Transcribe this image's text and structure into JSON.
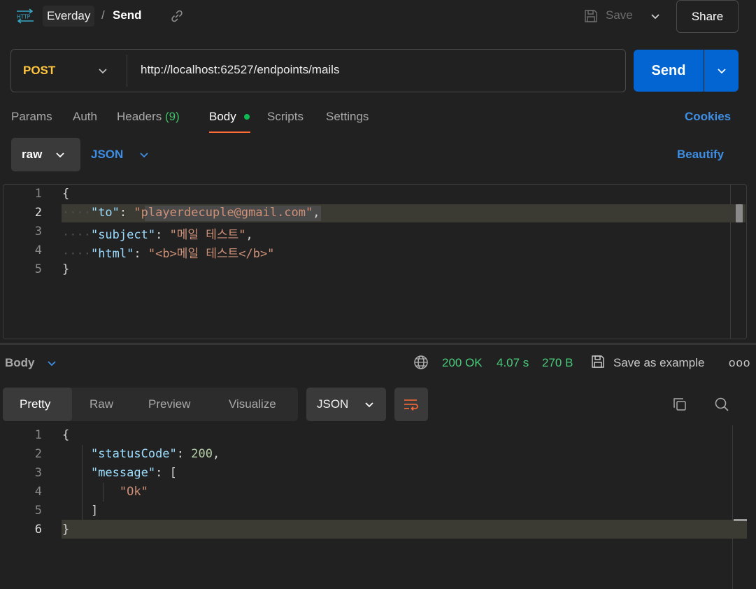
{
  "topbar": {
    "icon_label": "HTTP",
    "workspace": "Everday",
    "separator": "/",
    "request_name": "Send",
    "save_label": "Save",
    "share_label": "Share"
  },
  "request": {
    "method": "POST",
    "url": "http://localhost:62527/endpoints/mails",
    "send_label": "Send"
  },
  "tabs": {
    "params": "Params",
    "auth": "Auth",
    "headers": "Headers",
    "headers_count": "(9)",
    "body": "Body",
    "scripts": "Scripts",
    "settings": "Settings",
    "cookies": "Cookies"
  },
  "body_options": {
    "mode": "raw",
    "language": "JSON",
    "beautify": "Beautify"
  },
  "request_body": {
    "line_numbers": [
      "1",
      "2",
      "3",
      "4",
      "5"
    ],
    "open_brace": "{",
    "close_brace": "}",
    "to_key": "\"to\"",
    "to_value": "\"playerdecuple@gmail.com\"",
    "subject_key": "\"subject\"",
    "subject_value": "\"메일 테스트\"",
    "html_key": "\"html\"",
    "html_value": "\"<b>메일 테스트</b>\""
  },
  "response": {
    "body_label": "Body",
    "status": "200 OK",
    "time": "4.07 s",
    "size": "270 B",
    "save_as_example": "Save as example",
    "more": "ooo",
    "views": [
      "Pretty",
      "Raw",
      "Preview",
      "Visualize"
    ],
    "format": "JSON",
    "line_numbers": [
      "1",
      "2",
      "3",
      "4",
      "5",
      "6"
    ],
    "open_brace": "{",
    "close_brace": "}",
    "status_code_key": "\"statusCode\"",
    "status_code_value": "200",
    "message_key": "\"message\"",
    "open_bracket": "[",
    "close_bracket": "]",
    "message_value": "\"Ok\""
  },
  "colors": {
    "accent_blue": "#0265d2",
    "link_blue": "#3d8fe6",
    "method_yellow": "#ffc53d",
    "status_green": "#49c97a",
    "tab_underline": "#ff6c37"
  }
}
